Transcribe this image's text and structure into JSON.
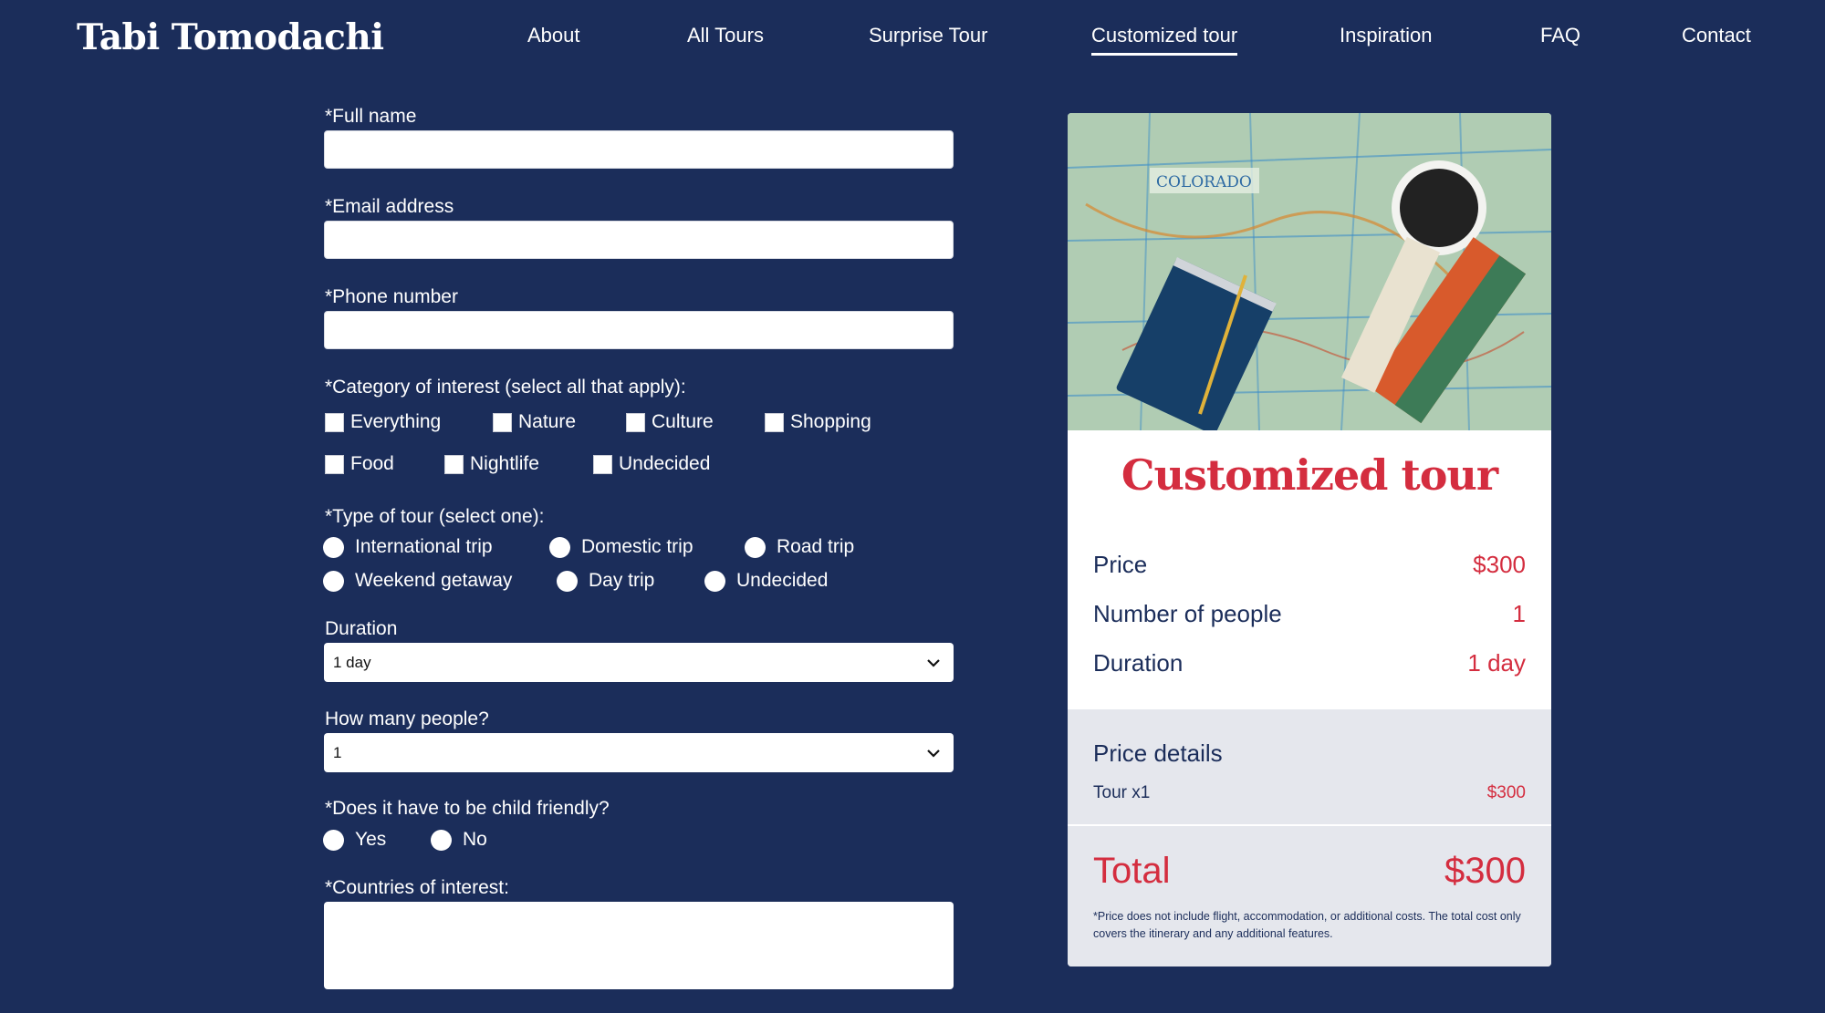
{
  "brand": "Tabi Tomodachi",
  "nav": [
    {
      "label": "About"
    },
    {
      "label": "All Tours"
    },
    {
      "label": "Surprise Tour"
    },
    {
      "label": "Customized tour",
      "active": true
    },
    {
      "label": "Inspiration"
    },
    {
      "label": "FAQ"
    },
    {
      "label": "Contact"
    }
  ],
  "form": {
    "full_name_label": "*Full name",
    "full_name_value": "",
    "email_label": "*Email address",
    "email_value": "",
    "phone_label": "*Phone number",
    "phone_value": "",
    "category_label": "*Category of interest (select all that apply):",
    "categories": [
      "Everything",
      "Nature",
      "Culture",
      "Shopping",
      "Food",
      "Nightlife",
      "Undecided"
    ],
    "tour_type_label": "*Type of tour (select one):",
    "tour_types": [
      "International trip",
      "Domestic trip",
      "Road trip",
      "Weekend getaway",
      "Day trip",
      "Undecided"
    ],
    "duration_label": "Duration",
    "duration_value": "1 day",
    "people_label": "How many people?",
    "people_value": "1",
    "child_label": "*Does it have to be child friendly?",
    "child_options": [
      "Yes",
      "No"
    ],
    "countries_label": "*Countries of interest:",
    "countries_value": ""
  },
  "card": {
    "image_map_text": "COLORADO",
    "title": "Customized tour",
    "rows": [
      {
        "label": "Price",
        "value": "$300"
      },
      {
        "label": "Number of people",
        "value": "1"
      },
      {
        "label": "Duration",
        "value": "1 day"
      }
    ],
    "details_heading": "Price details",
    "line_label": "Tour x1",
    "line_value": "$300",
    "total_label": "Total",
    "total_value": "$300",
    "note": "*Price does not include flight, accommodation, or additional costs. The total cost only covers the itinerary and any additional features."
  },
  "colors": {
    "background": "#1b2d5a",
    "accent": "#d42d3f",
    "panel": "#e5e7ed"
  },
  "icons": {
    "dropdown": "chevron-down-icon"
  }
}
